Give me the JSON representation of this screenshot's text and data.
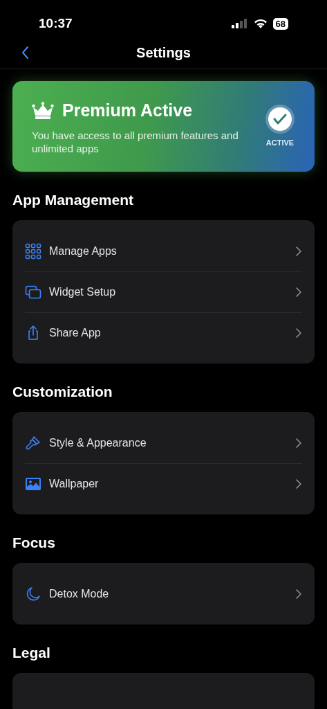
{
  "status_bar": {
    "time": "10:37",
    "battery": "68"
  },
  "nav": {
    "title": "Settings"
  },
  "premium": {
    "title": "Premium Active",
    "description": "You have access to all premium features and unlimited apps",
    "badge": "ACTIVE"
  },
  "sections": [
    {
      "title": "App Management",
      "items": [
        {
          "kind": "grid",
          "label": "Manage Apps"
        },
        {
          "kind": "windows",
          "label": "Widget Setup"
        },
        {
          "kind": "share",
          "label": "Share App"
        }
      ]
    },
    {
      "title": "Customization",
      "items": [
        {
          "kind": "brush",
          "label": "Style & Appearance"
        },
        {
          "kind": "image",
          "label": "Wallpaper"
        }
      ]
    },
    {
      "title": "Focus",
      "items": [
        {
          "kind": "moon",
          "label": "Detox Mode"
        }
      ]
    },
    {
      "title": "Legal"
    }
  ]
}
